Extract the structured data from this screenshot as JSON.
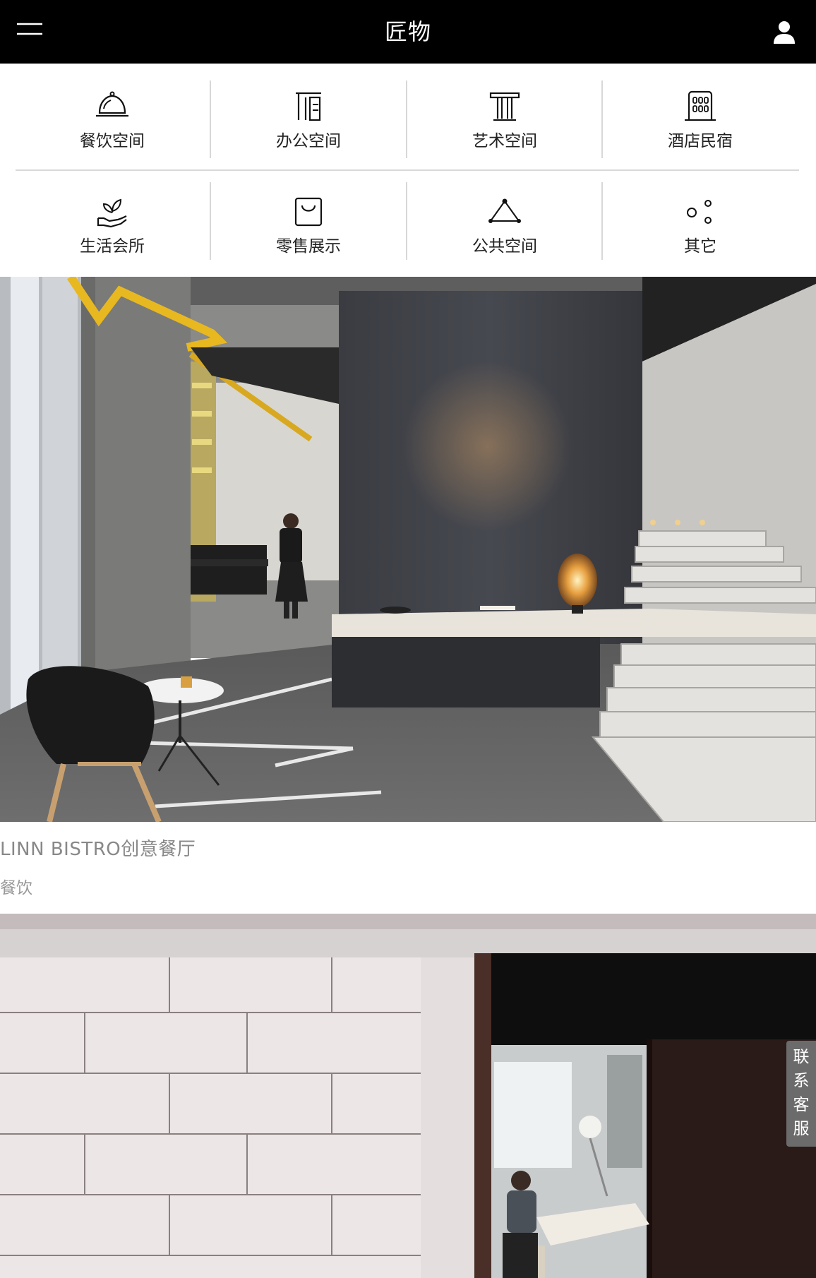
{
  "header": {
    "title": "匠物",
    "menu_icon": "hamburger-menu-icon",
    "user_icon": "user-icon"
  },
  "categories": [
    {
      "label": "餐饮空间",
      "icon": "food-cloche-icon"
    },
    {
      "label": "办公空间",
      "icon": "office-building-icon"
    },
    {
      "label": "艺术空间",
      "icon": "art-column-icon"
    },
    {
      "label": "酒店民宿",
      "icon": "hotel-building-icon"
    },
    {
      "label": "生活会所",
      "icon": "plant-hand-icon"
    },
    {
      "label": "零售展示",
      "icon": "shopping-bag-icon"
    },
    {
      "label": "公共空间",
      "icon": "triangle-network-icon"
    },
    {
      "label": "其它",
      "icon": "circles-icon"
    }
  ],
  "projects": [
    {
      "title": "LINN BISTRO创意餐厅",
      "tag": "餐饮"
    },
    {
      "title": "",
      "tag": ""
    }
  ],
  "contact": {
    "label": "联系客服"
  },
  "colors": {
    "header_bg": "#000000",
    "header_text": "#ffffff",
    "divider": "#d8d8d8",
    "contact_bg": "#6b6b6b"
  }
}
